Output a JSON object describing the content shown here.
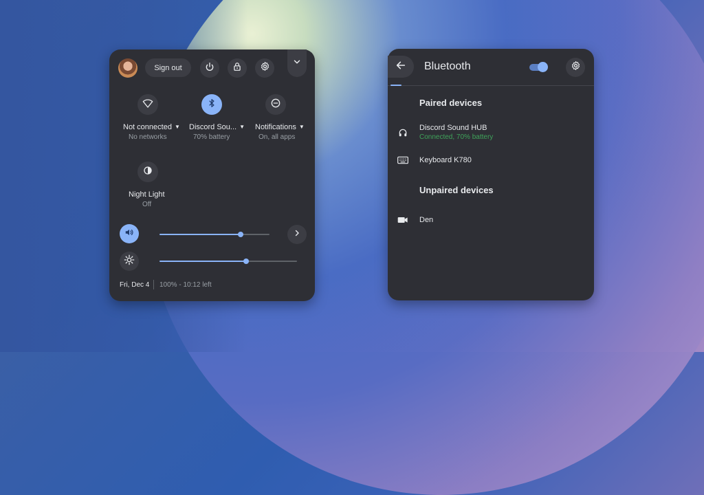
{
  "quick_settings": {
    "sign_out_label": "Sign out",
    "tiles": [
      {
        "label": "Not connected",
        "sub": "No networks",
        "icon": "wifi-off-icon"
      },
      {
        "label": "Discord Sou...",
        "sub": "70% battery",
        "icon": "bluetooth-icon"
      },
      {
        "label": "Notifications",
        "sub": "On, all apps",
        "icon": "do-not-disturb-icon"
      },
      {
        "label": "Night Light",
        "sub": "Off",
        "icon": "night-light-icon"
      }
    ],
    "volume_level": 0.74,
    "brightness_level": 0.63,
    "date": "Fri, Dec 4",
    "battery": "100% - 10:12 left"
  },
  "bluetooth": {
    "title": "Bluetooth",
    "enabled": true,
    "paired_heading": "Paired devices",
    "unpaired_heading": "Unpaired devices",
    "paired": [
      {
        "name": "Discord Sound HUB",
        "status": "Connected, 70% battery",
        "icon": "headphones-icon"
      },
      {
        "name": "Keyboard K780",
        "status": "",
        "icon": "keyboard-icon"
      }
    ],
    "unpaired": [
      {
        "name": "Den",
        "icon": "video-camera-icon"
      }
    ]
  },
  "colors": {
    "panel_bg": "#2e2f35",
    "accent": "#8ab4f8",
    "status_green": "#3fa35a"
  }
}
